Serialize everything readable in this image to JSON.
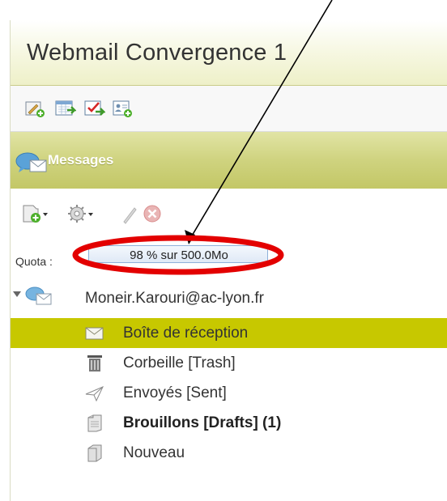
{
  "window": {
    "title": "Webmail Convergence 1"
  },
  "toolbar": {
    "icons": [
      "new-message-icon",
      "calendar-icon",
      "task-icon",
      "contacts-icon"
    ]
  },
  "section": {
    "title": "Messages",
    "icon": "messages-icon"
  },
  "actions": {
    "icons": [
      "new-folder-icon",
      "settings-icon",
      "edit-icon",
      "delete-icon"
    ]
  },
  "quota": {
    "label": "Quota :",
    "value": "98 % sur 500.0Mo"
  },
  "tree": {
    "account": "Moneir.Karouri@ac-lyon.fr",
    "folders": [
      {
        "label": "Boîte de réception",
        "icon": "envelope-icon",
        "selected": true
      },
      {
        "label": "Corbeille [Trash]",
        "icon": "trash-icon"
      },
      {
        "label": "Envoyés [Sent]",
        "icon": "sent-icon"
      },
      {
        "label": "Brouillons [Drafts] (1)",
        "icon": "drafts-icon",
        "bold": true
      },
      {
        "label": "Nouveau",
        "icon": "folder-icon"
      }
    ]
  },
  "colors": {
    "selected_row": "#c7c800",
    "section_header": "#cfd37f",
    "annotation_ellipse": "#e30000",
    "quota_border": "#8fb0d9"
  }
}
